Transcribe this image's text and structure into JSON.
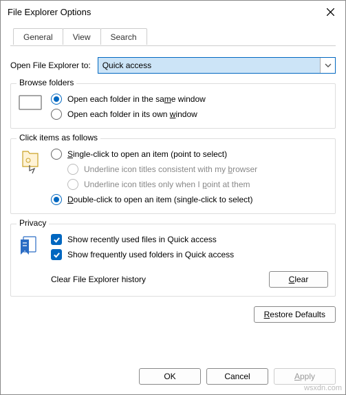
{
  "title": "File Explorer Options",
  "tabs": {
    "general": "General",
    "view": "View",
    "search": "Search"
  },
  "open_to_label": "Open File Explorer to:",
  "open_to_value": "Quick access",
  "browse": {
    "legend": "Browse folders",
    "same": "Open each folder in the sa",
    "same_u": "m",
    "same2": "e window",
    "own": "Open each folder in its own ",
    "own_u": "w",
    "own2": "indow"
  },
  "click": {
    "legend": "Click items as follows",
    "single_u": "S",
    "single": "ingle-click to open an item (point to select)",
    "uline1": "Underline icon titles consistent with my ",
    "uline1_u": "b",
    "uline1b": "rowser",
    "uline2": "Underline icon titles only when I ",
    "uline2_u": "p",
    "uline2b": "oint at them",
    "double_u": "D",
    "double": "ouble-click to open an item (single-click to select)"
  },
  "privacy": {
    "legend": "Privacy",
    "recent": "Show recently used files in Quick access",
    "freq": "Show frequently used folders in Quick access",
    "clear_label": "Clear File Explorer history",
    "clear_u": "C",
    "clear_btn": "lear"
  },
  "restore_u": "R",
  "restore": "estore Defaults",
  "ok": "OK",
  "cancel": "Cancel",
  "apply_u": "A",
  "apply": "pply",
  "watermark": "wsxdn.com"
}
